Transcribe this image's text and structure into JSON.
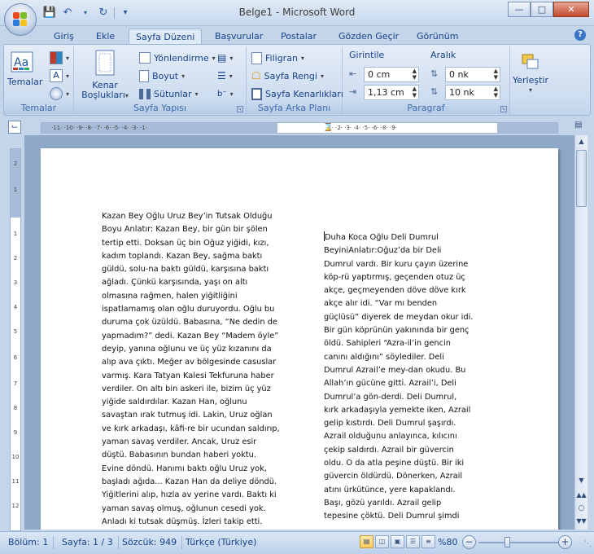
{
  "window": {
    "title": "Belge1 - Microsoft Word"
  },
  "tabs": [
    "Giriş",
    "Ekle",
    "Sayfa Düzeni",
    "Başvurular",
    "Postalar",
    "Gözden Geçir",
    "Görünüm"
  ],
  "ribbon": {
    "temalar": {
      "button": "Temalar",
      "group": "Temalar"
    },
    "sayfa_yapisi": {
      "kenar": "Kenar",
      "bosluklari": "Boşlukları",
      "yonlendirme": "Yönlendirme",
      "boyut": "Boyut",
      "sutunlar": "Sütunlar",
      "group": "Sayfa Yapısı"
    },
    "sayfa_arka_plani": {
      "filigran": "Filigran",
      "sayfa_rengi": "Sayfa Rengi",
      "sayfa_kenarliklari": "Sayfa Kenarlıkları",
      "group": "Sayfa Arka Planı"
    },
    "paragraf": {
      "girinti": "Girintile",
      "aralik": "Aralık",
      "left_value": "0 cm",
      "right_value": "1,13 cm",
      "before_value": "0 nk",
      "after_value": "10 nk",
      "group": "Paragraf"
    },
    "yerlestir": {
      "button": "Yerleştir"
    }
  },
  "document": {
    "left_column": [
      "Kazan Bey Oğlu Uruz Bey’in Tutsak Olduğu",
      "Boyu Anlatır: Kazan Bey, bir gün bir şölen",
      "tertip etti. Doksan üç bin Oğuz yiğidi, kızı,",
      "kadım toplandı. Kazan Bey, sağma baktı",
      "güldü, solu-na baktı güldü, karşısına baktı",
      "ağladı. Çünkü karşısında, yaşı on altı",
      "olmasına rağmen, halen yiğitliğini",
      "ispatlamamış olan oğlu duruyordu. Oğlu bu",
      "duruma çok üzüldü. Babasına, “Ne dedin de",
      "yapmadım?” dedi. Kazan Bey “Madem öyle”",
      "deyip, yanına oğlunu ve üç yüz kızanını da",
      "alıp ava çıktı. Meğer av bölgesinde casuslar",
      "varmış. Kara Tatyan Kalesi Tekfuruna haber",
      "verdiler. On altı bin askeri ile, bizim üç yüz",
      "yiğide saldırdılar. Kazan Han, oğlunu",
      "savaştan ırak tutmuş idi. Lakin, Uruz oğlan",
      "ve kırk arkadaşı, kâfi-re bir ucundan saldırıp,",
      "yaman savaş verdiler. Ancak, Uruz esir",
      "düştü. Babasının bundan haberi yoktu.",
      "Evine döndü. Hanımı baktı oğlu Uruz yok,",
      "başladı ağıda... Kazan Han da deliye döndü.",
      "Yiğitlerini alıp, hızla av yerine vardı. Baktı ki",
      "yaman savaş olmuş, oğlunun cesedi yok.",
      "Anladı ki tutsak düşmüş. İzleri takip etti."
    ],
    "right_column": [
      "Duha Koca Oğlu Deli Dumrul",
      "BeyiniAnlatır:Oğuz’da bir Deli",
      "Dumrul vardı. Bir kuru çayın üzerine",
      "köp-rü yaptırmış, geçenden otuz üç",
      "akçe, geçmeyenden döve döve kırk",
      "akçe alır idi. “Var mı benden",
      "güçlüsü” diyerek de meydan okur idi.",
      "Bir gün köprünün yakınında bir genç",
      "öldü. Sahipleri “Azra-il’in gencin",
      "canını aldığını” söylediler. Deli",
      "Dumrul Azrail’e mey-dan okudu. Bu",
      "Allah’ın gücüne gitti. Azrail’i, Deli",
      "Dumrul’a gön-derdi. Deli Dumrul,",
      "kırk arkadaşıyla yemekte iken, Azrail",
      "gelip kıstırdı. Deli Dumrul şaşırdı.",
      "Azrail olduğunu anlayınca, kılıcını",
      "çekip saldırdı. Azrail bir güvercin",
      "oldu. O da atla peşine düştü. Bir iki",
      "güvercin öldürdü. Dönerken, Azrail",
      "atını ürkütünce, yere kapaklandı.",
      "Başı, gözü yarıldı. Azrail gelip",
      "tepesine çöktü. Deli Dumrul şimdi"
    ]
  },
  "statusbar": {
    "bolum": "Bölüm: 1",
    "sayfa": "Sayfa: 1 / 3",
    "sozcuk": "Sözcük: 949",
    "dil": "Türkçe (Türkiye)",
    "zoom": "%80"
  }
}
